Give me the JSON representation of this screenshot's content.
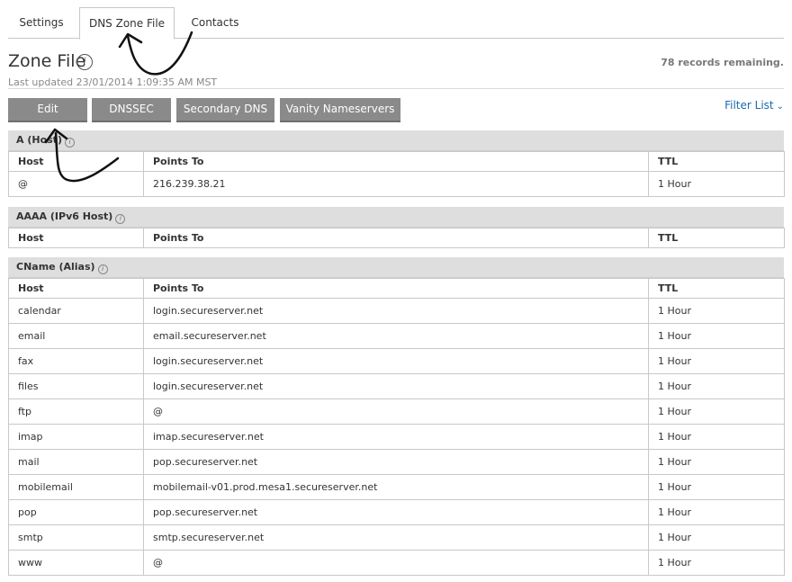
{
  "tabs": [
    {
      "label": "Settings"
    },
    {
      "label": "DNS Zone File"
    },
    {
      "label": "Contacts"
    }
  ],
  "header": {
    "title": "Zone File",
    "info_glyph": "i",
    "records_remaining": "78 records remaining.",
    "last_updated": "Last updated 23/01/2014 1:09:35 AM MST"
  },
  "toolbar": {
    "edit_label": "Edit",
    "dnssec_label": "DNSSEC",
    "secondary_dns_label": "Secondary DNS",
    "vanity_label": "Vanity Nameservers",
    "filter_label": "Filter List"
  },
  "columns": {
    "host": "Host",
    "points_to": "Points To",
    "ttl": "TTL"
  },
  "sections": [
    {
      "title": "A (Host)",
      "rows": [
        {
          "host": "@",
          "points_to": "216.239.38.21",
          "ttl": "1 Hour"
        }
      ]
    },
    {
      "title": "AAAA (IPv6 Host)",
      "rows": []
    },
    {
      "title": "CName (Alias)",
      "rows": [
        {
          "host": "calendar",
          "points_to": "login.secureserver.net",
          "ttl": "1 Hour"
        },
        {
          "host": "email",
          "points_to": "email.secureserver.net",
          "ttl": "1 Hour"
        },
        {
          "host": "fax",
          "points_to": "login.secureserver.net",
          "ttl": "1 Hour"
        },
        {
          "host": "files",
          "points_to": "login.secureserver.net",
          "ttl": "1 Hour"
        },
        {
          "host": "ftp",
          "points_to": "@",
          "ttl": "1 Hour"
        },
        {
          "host": "imap",
          "points_to": "imap.secureserver.net",
          "ttl": "1 Hour"
        },
        {
          "host": "mail",
          "points_to": "pop.secureserver.net",
          "ttl": "1 Hour"
        },
        {
          "host": "mobilemail",
          "points_to": "mobilemail-v01.prod.mesa1.secureserver.net",
          "ttl": "1 Hour"
        },
        {
          "host": "pop",
          "points_to": "pop.secureserver.net",
          "ttl": "1 Hour"
        },
        {
          "host": "smtp",
          "points_to": "smtp.secureserver.net",
          "ttl": "1 Hour"
        },
        {
          "host": "www",
          "points_to": "@",
          "ttl": "1 Hour"
        }
      ]
    }
  ],
  "colors": {
    "button_bg": "#8a8a8a",
    "section_header_bg": "#dedede",
    "link": "#1a6ab3"
  },
  "icons": [
    "info-icon",
    "chevron-down-icon",
    "hand-drawn-arrow-annotation"
  ]
}
